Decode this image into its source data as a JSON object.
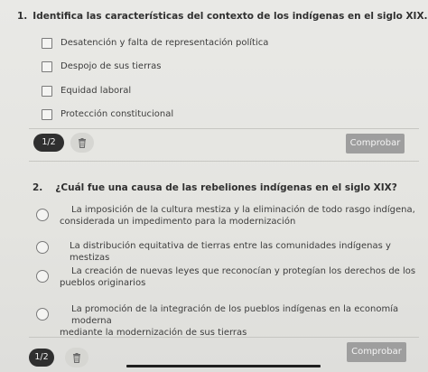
{
  "question1": {
    "number": "1.",
    "text": "Identifica las características del contexto de los indígenas en el siglo XIX.",
    "options": [
      "Desatención y falta de representación política",
      "Despojo de sus tierras",
      "Equidad laboral",
      "Protección constitucional"
    ],
    "progress": "1/2",
    "check_label": "Comprobar"
  },
  "question2": {
    "number": "2.",
    "text": "¿Cuál fue una causa de las rebeliones indígenas en el siglo XIX?",
    "options": [
      {
        "line1": "La imposición de la cultura mestiza y la eliminación de todo rasgo indígena,",
        "line2": "considerada un impedimento para la modernización"
      },
      {
        "line1": "La distribución equitativa de tierras entre las comunidades indígenas y mestizas",
        "line2": ""
      },
      {
        "line1": "La creación de nuevas leyes que reconocían y protegían los derechos de los",
        "line2": "pueblos originarios"
      },
      {
        "line1": "La promoción de la integración de los pueblos indígenas en la economía moderna",
        "line2": "mediante la modernización de sus tierras"
      }
    ],
    "progress": "1/2",
    "check_label": "Comprobar"
  },
  "icons": {
    "trash": "trash-icon"
  },
  "colors": {
    "badge": "#2f2f2f",
    "check_button": "#9e9e9e"
  }
}
